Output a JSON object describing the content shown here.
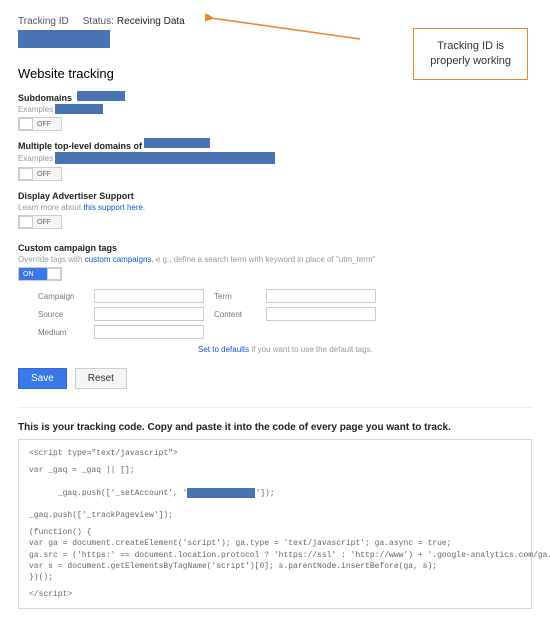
{
  "header": {
    "tracking_label": "Tracking ID",
    "status_label": "Status:",
    "status_value": "Receiving Data"
  },
  "callout": {
    "line1": "Tracking ID is",
    "line2": "properly working"
  },
  "website_tracking": {
    "title": "Website tracking",
    "subdomains": {
      "label": "Subdomains",
      "examples": "Examples",
      "toggle": "OFF"
    },
    "multidomain": {
      "label": "Multiple top-level domains of",
      "examples": "Examples",
      "toggle": "OFF"
    },
    "advertiser": {
      "label": "Display Advertiser Support",
      "learn_prefix": "Learn more about ",
      "learn_link": "this support here",
      "toggle": "OFF"
    }
  },
  "campaign": {
    "title": "Custom campaign tags",
    "desc_prefix": "Override tags with ",
    "desc_link": "custom campaigns",
    "desc_suffix": ", e.g., define a search term with keyword in place of \"utm_term\"",
    "toggle": "ON",
    "fields": {
      "campaign": "Campaign",
      "term": "Term",
      "source": "Source",
      "content": "Content",
      "medium": "Medium"
    },
    "defaults_link": "Set to defaults",
    "defaults_suffix": " if you want to use the default tags."
  },
  "actions": {
    "save": "Save",
    "reset": "Reset"
  },
  "code_block": {
    "title": "This is your tracking code. Copy and paste it into the code of every page you want to track.",
    "l1": "<script type=\"text/javascript\">",
    "l2": "var _gaq = _gaq || [];",
    "l3a": "_gaq.push(['_setAccount', '",
    "l3b": "']);",
    "l4": "_gaq.push(['_trackPageview']);",
    "l5": "(function() {",
    "l6": "var ga = document.createElement('script'); ga.type = 'text/javascript'; ga.async = true;",
    "l7": "ga.src = ('https:' == document.location.protocol ? 'https://ssl' : 'http://www') + '.google-analytics.com/ga.js';",
    "l8": "var s = document.getElementsByTagName('script')[0]; s.parentNode.insertBefore(ga, s);",
    "l9": "})();",
    "l10": "</script>"
  }
}
